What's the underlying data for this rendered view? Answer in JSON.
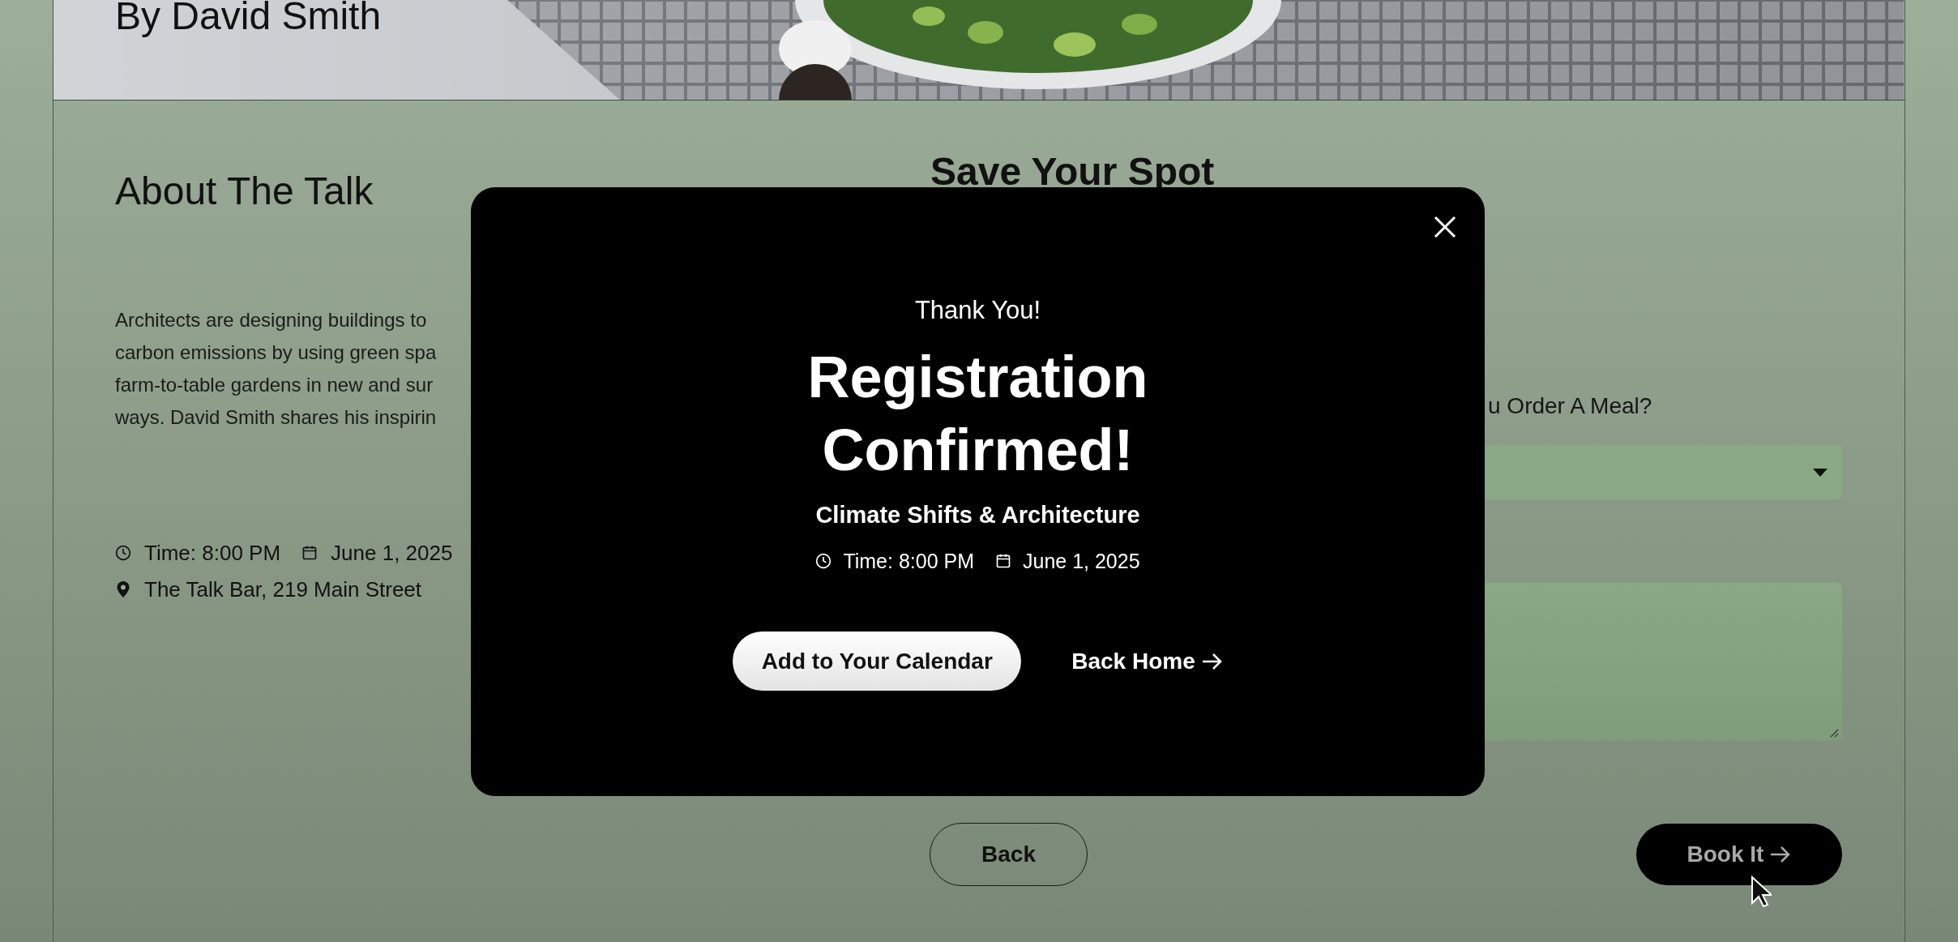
{
  "hero": {
    "title": "By David Smith"
  },
  "about": {
    "heading": "About The Talk",
    "paragraph_lines": [
      "Architects are designing buildings to",
      "carbon emissions by using green spa",
      "farm-to-table gardens in new and sur",
      "ways. David Smith shares his inspirin"
    ],
    "time": "Time: 8:00 PM",
    "date": "June 1, 2025",
    "location": "The Talk Bar, 219 Main Street"
  },
  "booking": {
    "heading": "Save Your Spot",
    "meal_label": "u Order A Meal?",
    "back_button": "Back",
    "submit_button": "Book It"
  },
  "modal": {
    "eyebrow": "Thank You!",
    "title": "Registration Confirmed!",
    "event": "Climate Shifts & Architecture",
    "time": "Time: 8:00 PM",
    "date": "June 1, 2025",
    "primary_button": "Add to Your Calendar",
    "secondary_link": "Back Home"
  }
}
